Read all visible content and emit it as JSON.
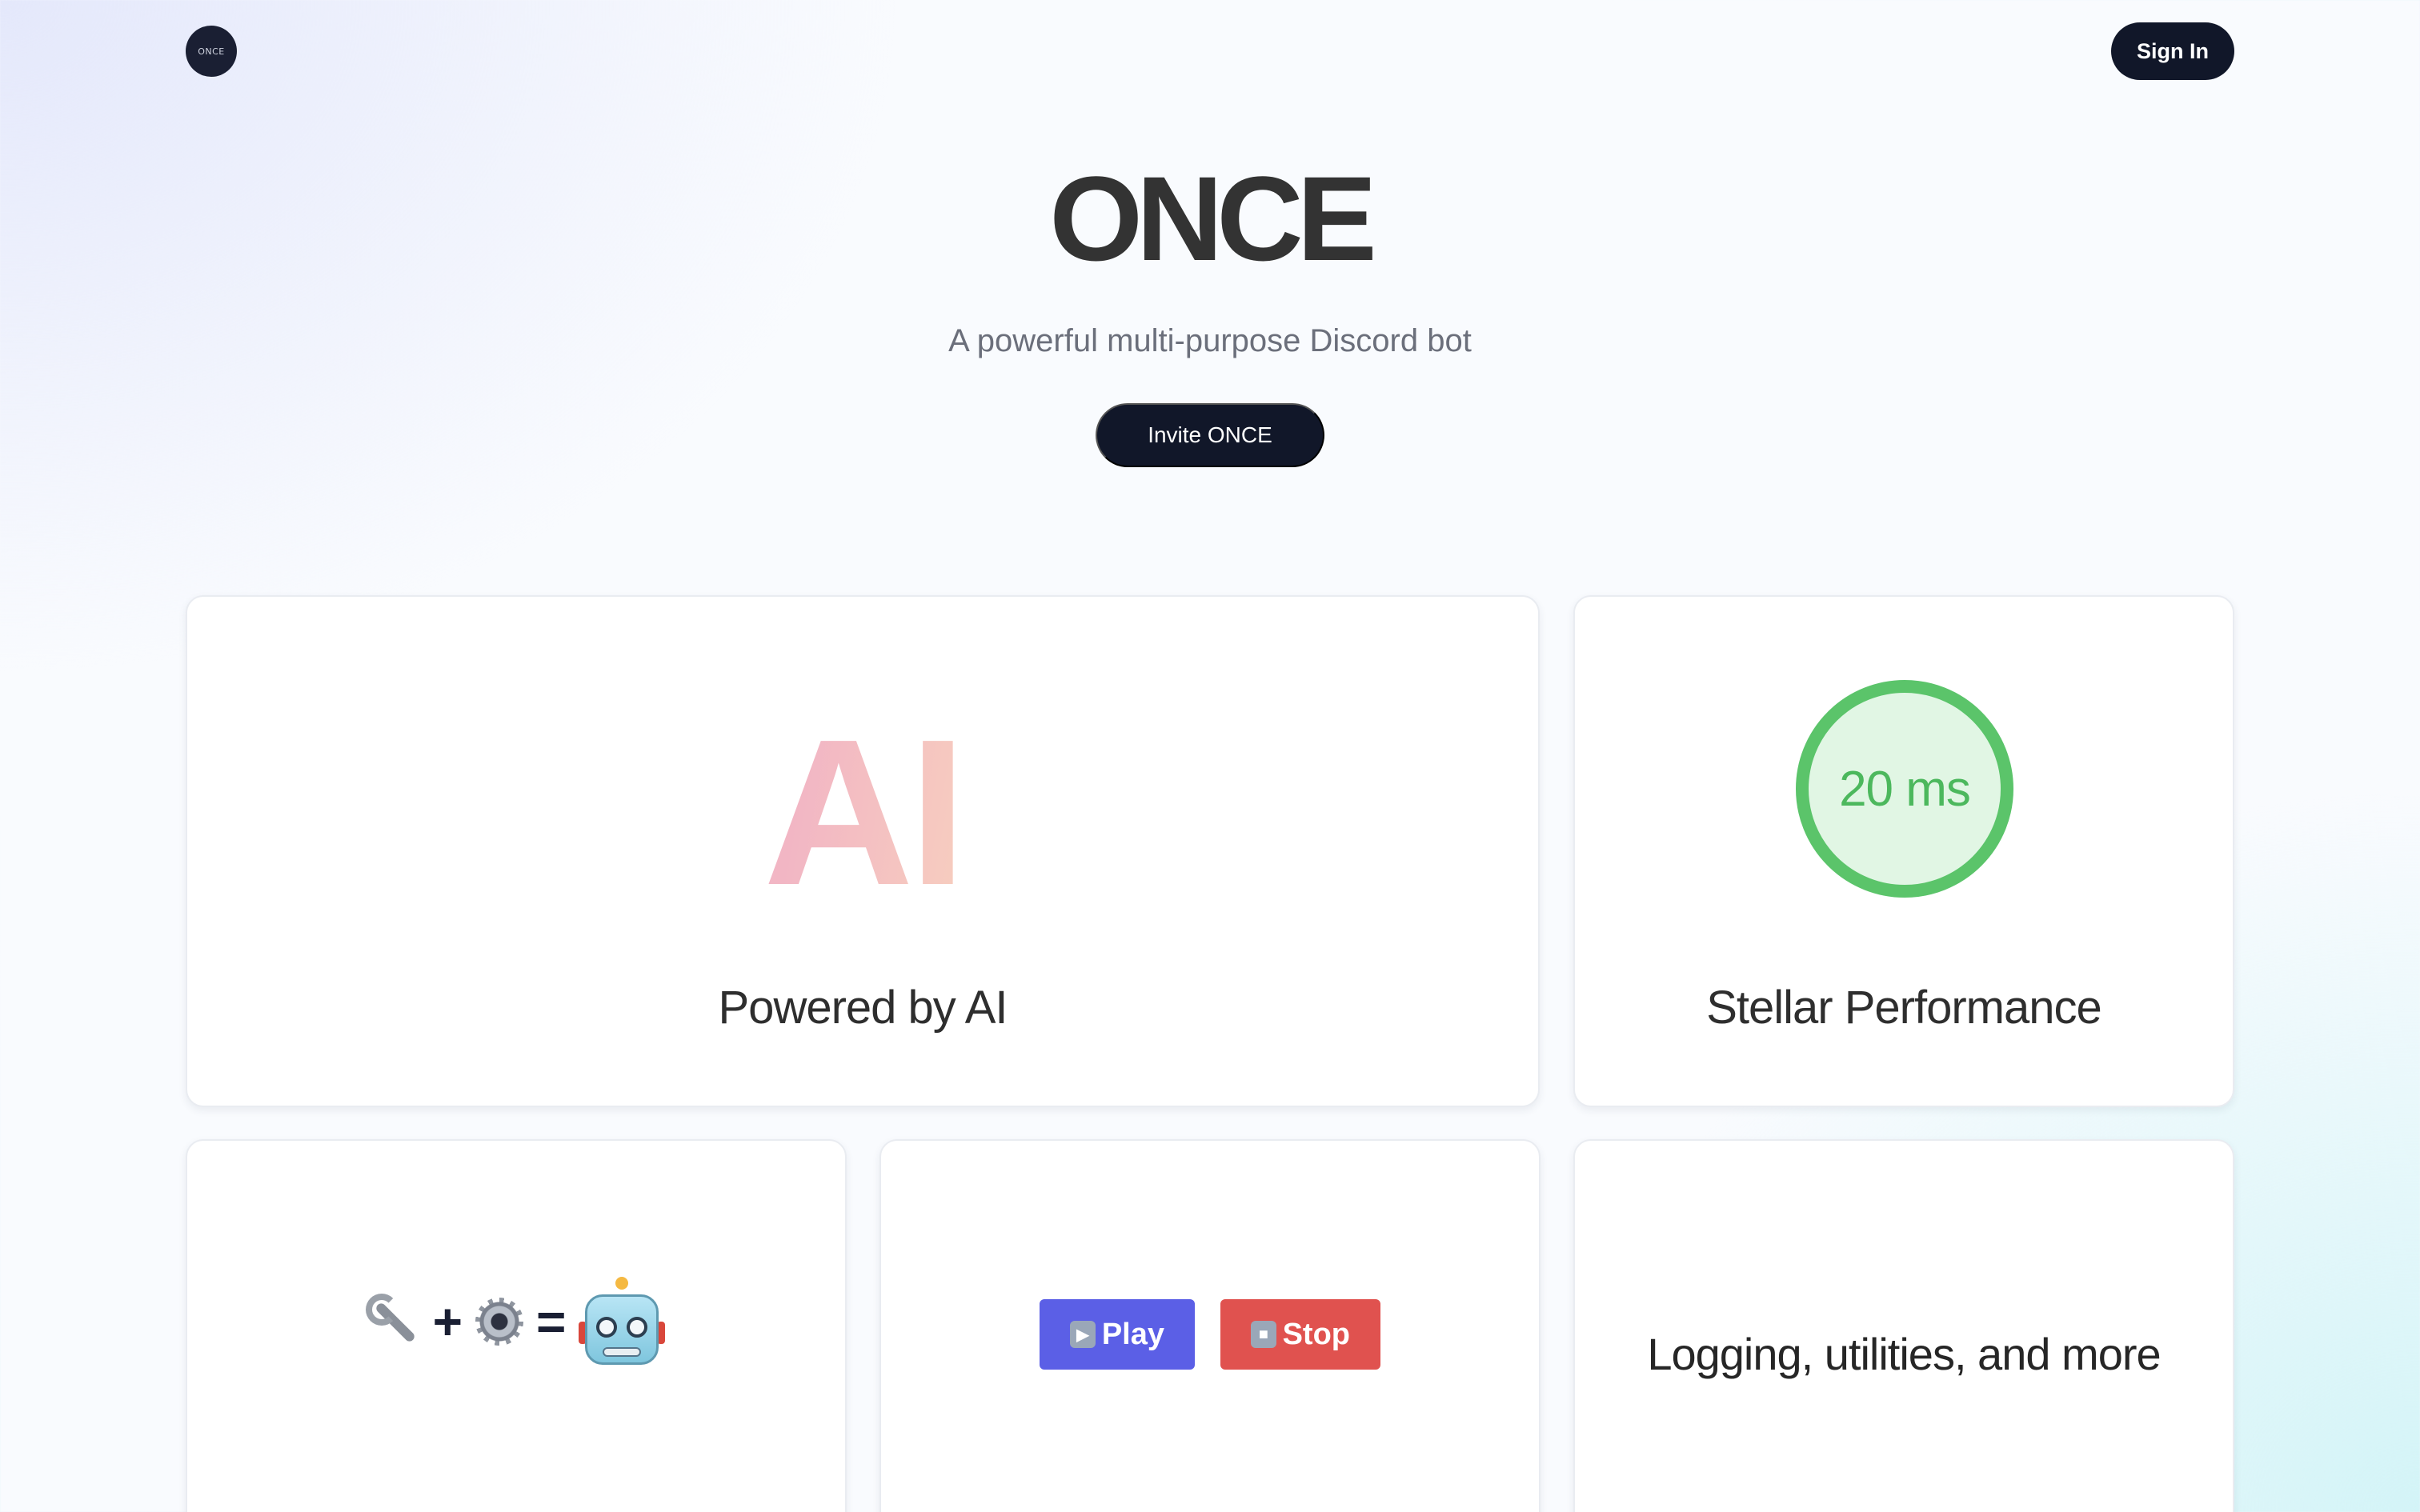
{
  "header": {
    "logo_text": "ONCE",
    "sign_in_label": "Sign In"
  },
  "hero": {
    "title": "ONCE",
    "subtitle": "A powerful multi-purpose Discord bot",
    "invite_label": "Invite ONCE"
  },
  "features": {
    "ai": {
      "graphic_text": "AI",
      "label": "Powered by AI"
    },
    "performance": {
      "ping": "20 ms",
      "label": "Stellar Performance",
      "accent_color": "#5bc46a"
    },
    "tools": {
      "plus": "+",
      "equals": "=",
      "icons": [
        "wrench-icon",
        "gear-icon",
        "robot-icon"
      ]
    },
    "music": {
      "play_label": "Play",
      "stop_label": "Stop",
      "play_color": "#5b5fe6",
      "stop_color": "#e0524f"
    },
    "more": {
      "label": "Logging, utilities, and more"
    }
  },
  "colors": {
    "brand_dark": "#111729"
  }
}
